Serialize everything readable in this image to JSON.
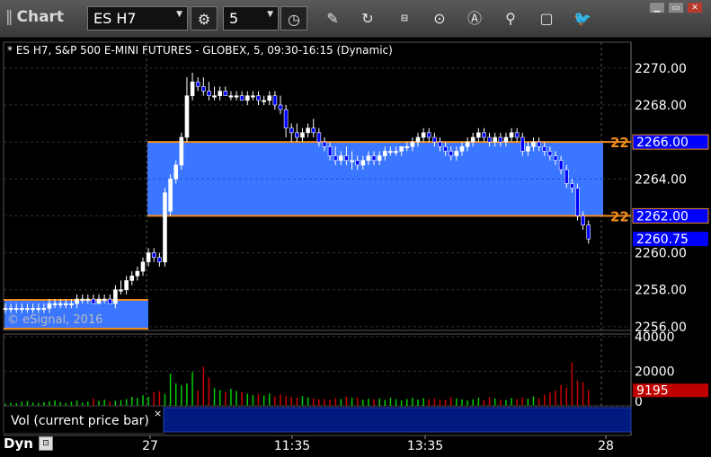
{
  "toolbar": {
    "title": "Chart",
    "symbol": "ES H7",
    "interval": "5",
    "icons": [
      "settings-icon",
      "clock-icon",
      "pencil-icon",
      "refresh-icon",
      "get-icon",
      "play-icon",
      "alert-icon",
      "link-icon",
      "comment-icon",
      "twitter-icon"
    ],
    "window_buttons": [
      "minimize-icon",
      "maximize-icon",
      "close-icon"
    ]
  },
  "chart_header": "* ES H7, S&P 500 E-MINI FUTURES - GLOBEX, 5, 09:30-16:15 (Dynamic)",
  "watermark": "© eSignal, 2016",
  "footer": {
    "mode": "Dyn",
    "icon": "lock-icon"
  },
  "colors": {
    "up": "#ffffff",
    "down": "#0000ff",
    "zone": "#3a76ff",
    "zone_line": "#f08c1e",
    "price_tag": "#0000ff",
    "vol_up": "#00cc00",
    "vol_down": "#cc0000"
  },
  "chart_data": {
    "type": "candlestick",
    "y_ticks": [
      "2270.00",
      "2268.00",
      "2266.00",
      "2264.00",
      "2262.00",
      "2260.00",
      "2258.00",
      "2256.00"
    ],
    "ylim": [
      2255.8,
      2271.4
    ],
    "x_labels": [
      "27",
      "11:35",
      "13:35",
      "28"
    ],
    "last_price": "2260.75",
    "zones": [
      {
        "label": "22",
        "top": 2266.0,
        "bottom": 2262.0,
        "top_tag": "2266.00",
        "bottom_tag": "2262.00"
      },
      {
        "top": 2257.45,
        "bottom": 2255.9
      }
    ],
    "candles": [
      [
        2257.0,
        2257.25,
        2256.75,
        2257.0
      ],
      [
        2257.0,
        2257.25,
        2256.75,
        2257.0
      ],
      [
        2257.0,
        2257.25,
        2256.75,
        2257.0
      ],
      [
        2257.0,
        2257.25,
        2256.75,
        2257.0
      ],
      [
        2257.0,
        2257.25,
        2256.75,
        2257.0
      ],
      [
        2257.0,
        2257.25,
        2256.75,
        2257.0
      ],
      [
        2257.0,
        2257.25,
        2256.75,
        2257.0
      ],
      [
        2257.0,
        2257.25,
        2256.75,
        2257.0
      ],
      [
        2257.0,
        2257.5,
        2256.75,
        2257.25
      ],
      [
        2257.25,
        2257.5,
        2257.0,
        2257.25
      ],
      [
        2257.25,
        2257.5,
        2257.0,
        2257.25
      ],
      [
        2257.25,
        2257.5,
        2257.0,
        2257.25
      ],
      [
        2257.25,
        2257.5,
        2257.0,
        2257.25
      ],
      [
        2257.25,
        2257.75,
        2257.0,
        2257.5
      ],
      [
        2257.5,
        2257.75,
        2257.25,
        2257.5
      ],
      [
        2257.5,
        2257.75,
        2257.25,
        2257.5
      ],
      [
        2257.5,
        2257.75,
        2257.25,
        2257.25
      ],
      [
        2257.25,
        2257.75,
        2257.25,
        2257.5
      ],
      [
        2257.5,
        2257.75,
        2257.25,
        2257.5
      ],
      [
        2257.5,
        2257.75,
        2257.25,
        2257.25
      ],
      [
        2257.25,
        2258.25,
        2257.0,
        2258.0
      ],
      [
        2258.0,
        2258.5,
        2257.75,
        2258.0
      ],
      [
        2258.0,
        2258.75,
        2257.75,
        2258.5
      ],
      [
        2258.5,
        2259.0,
        2258.25,
        2258.75
      ],
      [
        2258.75,
        2259.25,
        2258.5,
        2259.0
      ],
      [
        2259.0,
        2259.75,
        2258.75,
        2259.5
      ],
      [
        2259.5,
        2260.25,
        2259.25,
        2260.0
      ],
      [
        2260.0,
        2260.25,
        2259.5,
        2259.75
      ],
      [
        2259.75,
        2260.0,
        2259.25,
        2259.5
      ],
      [
        2259.5,
        2263.5,
        2259.25,
        2263.25
      ],
      [
        2262.25,
        2264.25,
        2262.0,
        2264.0
      ],
      [
        2264.0,
        2265.0,
        2263.75,
        2264.75
      ],
      [
        2264.75,
        2266.5,
        2264.5,
        2266.25
      ],
      [
        2266.25,
        2269.5,
        2266.0,
        2268.5
      ],
      [
        2268.5,
        2269.75,
        2268.25,
        2269.25
      ],
      [
        2269.25,
        2269.5,
        2268.75,
        2269.0
      ],
      [
        2269.0,
        2269.5,
        2268.5,
        2268.75
      ],
      [
        2268.75,
        2269.25,
        2268.25,
        2268.5
      ],
      [
        2268.5,
        2269.0,
        2268.25,
        2268.5
      ],
      [
        2268.5,
        2269.0,
        2268.25,
        2268.75
      ],
      [
        2268.75,
        2269.0,
        2268.5,
        2268.5
      ],
      [
        2268.5,
        2268.75,
        2268.25,
        2268.5
      ],
      [
        2268.5,
        2268.75,
        2268.25,
        2268.5
      ],
      [
        2268.5,
        2268.75,
        2268.25,
        2268.25
      ],
      [
        2268.25,
        2268.75,
        2268.0,
        2268.5
      ],
      [
        2268.5,
        2268.75,
        2268.25,
        2268.5
      ],
      [
        2268.5,
        2268.75,
        2268.0,
        2268.25
      ],
      [
        2268.25,
        2268.5,
        2268.0,
        2268.25
      ],
      [
        2268.25,
        2268.75,
        2268.0,
        2268.5
      ],
      [
        2268.5,
        2268.75,
        2267.75,
        2268.0
      ],
      [
        2268.0,
        2268.5,
        2267.5,
        2267.75
      ],
      [
        2267.75,
        2268.0,
        2266.25,
        2266.75
      ],
      [
        2266.75,
        2267.0,
        2266.0,
        2266.5
      ],
      [
        2266.5,
        2267.0,
        2266.0,
        2266.25
      ],
      [
        2266.25,
        2266.75,
        2266.0,
        2266.5
      ],
      [
        2266.5,
        2267.0,
        2266.25,
        2266.75
      ],
      [
        2266.75,
        2267.25,
        2266.25,
        2266.5
      ],
      [
        2266.5,
        2266.75,
        2265.75,
        2266.0
      ],
      [
        2266.0,
        2266.25,
        2265.5,
        2265.75
      ],
      [
        2265.75,
        2266.0,
        2265.0,
        2265.25
      ],
      [
        2265.25,
        2265.75,
        2264.75,
        2265.0
      ],
      [
        2265.0,
        2265.5,
        2264.75,
        2265.25
      ],
      [
        2265.25,
        2265.75,
        2264.75,
        2265.0
      ],
      [
        2265.0,
        2265.5,
        2264.5,
        2265.0
      ],
      [
        2265.0,
        2265.25,
        2264.5,
        2264.75
      ],
      [
        2264.75,
        2265.25,
        2264.5,
        2265.0
      ],
      [
        2265.0,
        2265.5,
        2264.75,
        2265.25
      ],
      [
        2265.25,
        2265.5,
        2264.75,
        2265.0
      ],
      [
        2265.0,
        2265.5,
        2264.75,
        2265.25
      ],
      [
        2265.25,
        2265.75,
        2265.0,
        2265.5
      ],
      [
        2265.5,
        2265.75,
        2265.25,
        2265.5
      ],
      [
        2265.5,
        2265.75,
        2265.25,
        2265.5
      ],
      [
        2265.5,
        2265.75,
        2265.25,
        2265.75
      ],
      [
        2265.75,
        2266.0,
        2265.5,
        2265.75
      ],
      [
        2265.75,
        2266.25,
        2265.5,
        2266.0
      ],
      [
        2266.0,
        2266.5,
        2265.75,
        2266.25
      ],
      [
        2266.25,
        2266.75,
        2266.0,
        2266.5
      ],
      [
        2266.5,
        2266.75,
        2266.0,
        2266.25
      ],
      [
        2266.25,
        2266.5,
        2265.75,
        2266.0
      ],
      [
        2266.0,
        2266.25,
        2265.5,
        2265.75
      ],
      [
        2265.75,
        2266.0,
        2265.25,
        2265.5
      ],
      [
        2265.5,
        2265.75,
        2265.0,
        2265.25
      ],
      [
        2265.25,
        2265.75,
        2265.0,
        2265.5
      ],
      [
        2265.5,
        2266.0,
        2265.25,
        2265.75
      ],
      [
        2265.75,
        2266.25,
        2265.5,
        2266.0
      ],
      [
        2266.0,
        2266.5,
        2265.75,
        2266.25
      ],
      [
        2266.25,
        2266.75,
        2266.0,
        2266.5
      ],
      [
        2266.5,
        2266.75,
        2266.0,
        2266.25
      ],
      [
        2266.25,
        2266.5,
        2265.75,
        2266.0
      ],
      [
        2266.0,
        2266.5,
        2265.75,
        2266.25
      ],
      [
        2266.25,
        2266.5,
        2265.75,
        2266.0
      ],
      [
        2266.0,
        2266.5,
        2265.75,
        2266.25
      ],
      [
        2266.25,
        2266.75,
        2266.0,
        2266.5
      ],
      [
        2266.5,
        2266.75,
        2266.0,
        2266.25
      ],
      [
        2266.25,
        2266.5,
        2265.25,
        2265.5
      ],
      [
        2265.5,
        2266.0,
        2265.25,
        2265.75
      ],
      [
        2265.75,
        2266.25,
        2265.5,
        2266.0
      ],
      [
        2266.0,
        2266.25,
        2265.5,
        2265.75
      ],
      [
        2265.75,
        2266.0,
        2265.25,
        2265.5
      ],
      [
        2265.5,
        2265.75,
        2265.0,
        2265.25
      ],
      [
        2265.25,
        2265.5,
        2264.75,
        2265.0
      ],
      [
        2265.0,
        2265.25,
        2264.25,
        2264.5
      ],
      [
        2264.5,
        2264.75,
        2263.5,
        2263.75
      ],
      [
        2263.75,
        2264.0,
        2263.25,
        2263.5
      ],
      [
        2263.5,
        2263.75,
        2261.75,
        2262.0
      ],
      [
        2262.0,
        2262.25,
        2261.25,
        2261.5
      ],
      [
        2261.5,
        2261.75,
        2260.5,
        2260.75
      ]
    ],
    "volume": {
      "y_ticks": [
        "40000",
        "20000",
        "0"
      ],
      "ylim": [
        0,
        41500
      ],
      "last": "9195",
      "label": "Vol (current price bar)",
      "values": [
        1200,
        1800,
        1500,
        2400,
        2800,
        1900,
        1600,
        2100,
        2600,
        3200,
        2200,
        1700,
        2400,
        3100,
        1900,
        2500,
        4200,
        2800,
        3600,
        2600,
        3000,
        3300,
        3900,
        5200,
        4600,
        6100,
        5300,
        7800,
        8400,
        6900,
        18600,
        13000,
        11800,
        12900,
        19600,
        8800,
        22600,
        16400,
        10200,
        9200,
        7800,
        9800,
        8600,
        8100,
        7000,
        6200,
        6800,
        5900,
        7100,
        5400,
        6600,
        5800,
        5200,
        4700,
        5600,
        4900,
        4300,
        3800,
        4100,
        3600,
        4400,
        3900,
        5200,
        4600,
        4800,
        3500,
        4100,
        3900,
        4300,
        3400,
        4600,
        3800,
        3200,
        3900,
        4700,
        3600,
        4500,
        3800,
        4200,
        3300,
        3600,
        4900,
        4300,
        3700,
        3100,
        3800,
        4600,
        3500,
        5100,
        4200,
        3700,
        3300,
        4500,
        3900,
        4800,
        4100,
        5400,
        4300,
        6500,
        7900,
        8900,
        12000,
        10400,
        25000,
        14600,
        13600,
        9195
      ]
    }
  }
}
